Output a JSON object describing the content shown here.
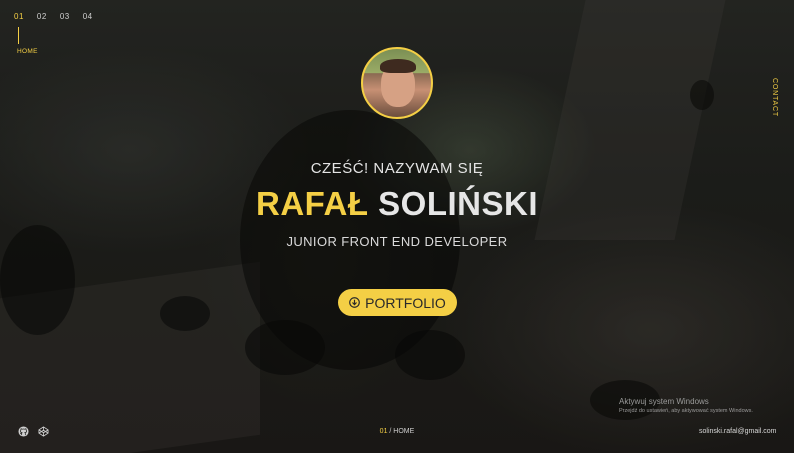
{
  "nav": {
    "items": [
      "01",
      "02",
      "03",
      "04"
    ],
    "active_index": 0,
    "active_label": "HOME"
  },
  "side": {
    "contact_label": "CONTACT"
  },
  "hero": {
    "greeting": "CZEŚĆ! NAZYWAM SIĘ",
    "first_name": "RAFAŁ",
    "last_name": "SOLIŃSKI",
    "role": "JUNIOR FRONT END DEVELOPER",
    "button_label": "PORTFOLIO",
    "button_icon": "download-circle-icon"
  },
  "footer": {
    "social_icons": [
      "github-icon",
      "codepen-icon"
    ],
    "page_number": "01",
    "page_label": "/ HOME",
    "email": "solinski.rafal@gmail.com"
  },
  "windows_notice": {
    "title": "Aktywuj system Windows",
    "subtitle": "Przejdź do ustawień, aby aktywować system Windows."
  },
  "colors": {
    "accent": "#f4cf45",
    "text": "#e6e6e6",
    "background": "#1c1d1a"
  }
}
